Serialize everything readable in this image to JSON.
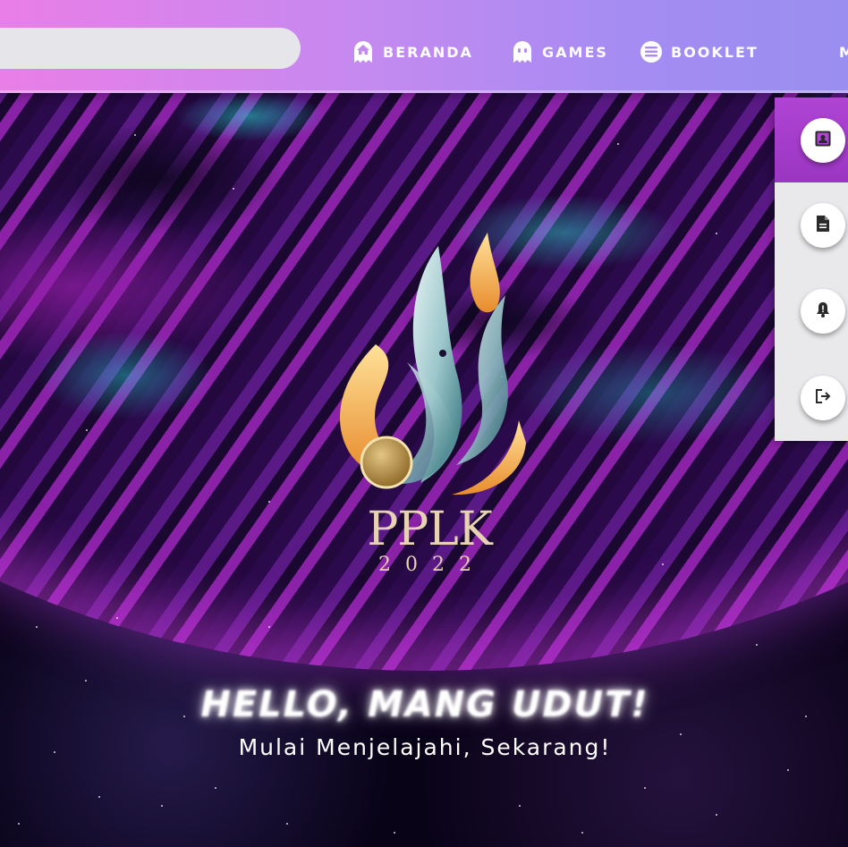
{
  "nav": {
    "items": [
      {
        "label": "BERANDA",
        "icon": "home-ghost-icon"
      },
      {
        "label": "GAMES",
        "icon": "ghost-icon"
      },
      {
        "label": "BOOKLET",
        "icon": "booklet-icon"
      },
      {
        "label": "M",
        "icon": ""
      }
    ]
  },
  "side_panel": {
    "buttons": [
      {
        "icon": "profile-card-icon",
        "active": true
      },
      {
        "icon": "document-icon",
        "active": false
      },
      {
        "icon": "bell-icon",
        "active": false
      },
      {
        "icon": "logout-icon",
        "active": false
      }
    ]
  },
  "logo": {
    "name": "PPLK",
    "year": "2022"
  },
  "hero": {
    "greeting": "HELLO, MANG UDUT!",
    "subtitle": "Mulai Menjelajahi, Sekarang!"
  },
  "colors": {
    "navbar_start": "#e97ee7",
    "navbar_end": "#9a8ef0",
    "side_active": "#b044d4",
    "logo_gold": "#e7d3b4"
  }
}
